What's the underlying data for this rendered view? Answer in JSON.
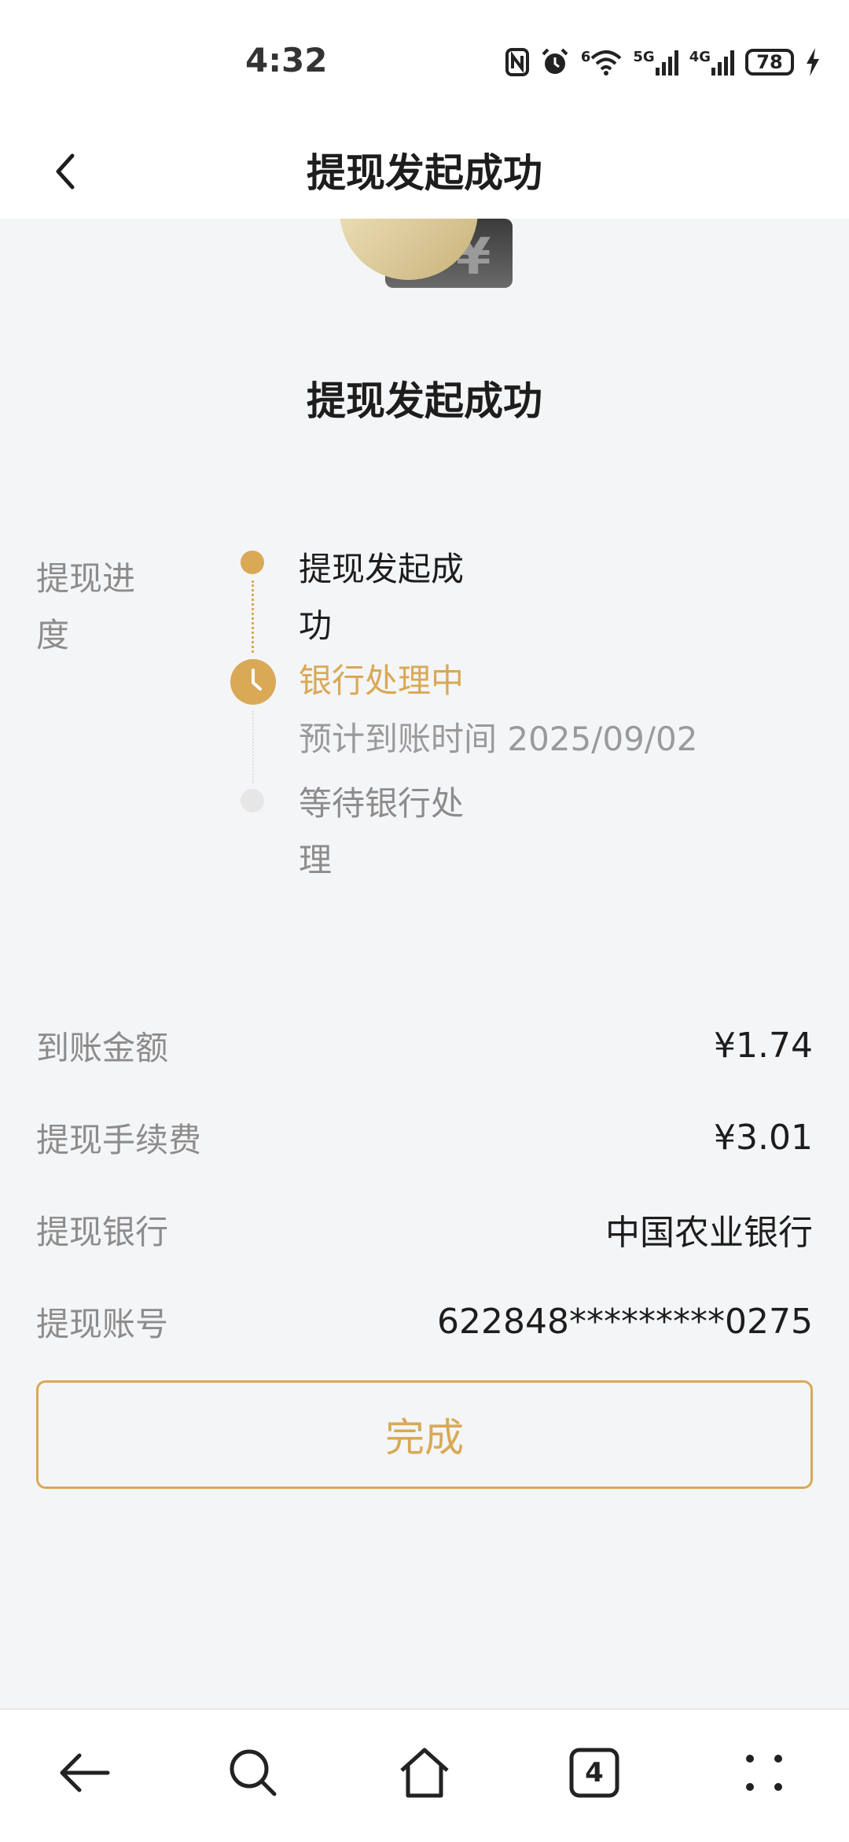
{
  "status_bar": {
    "time": "4:32",
    "wifi_tag": "6",
    "sim1_tag": "5G",
    "sim2_tag": "4G",
    "battery": "78"
  },
  "header": {
    "title": "提现发起成功"
  },
  "hero": {
    "currency_symbol": "¥"
  },
  "main": {
    "title": "提现发起成功"
  },
  "progress": {
    "label": "提现进度",
    "steps": [
      {
        "text": "提现发起成功",
        "state": "done"
      },
      {
        "text": "银行处理中",
        "sub": "预计到账时间 2025/09/02",
        "state": "current"
      },
      {
        "text": "等待银行处理",
        "state": "pending"
      }
    ]
  },
  "details": [
    {
      "label": "到账金额",
      "value": "¥1.74"
    },
    {
      "label": "提现手续费",
      "value": "¥3.01"
    },
    {
      "label": "提现银行",
      "value": "中国农业银行"
    },
    {
      "label": "提现账号",
      "value": "622848*********0275"
    }
  ],
  "actions": {
    "done_label": "完成"
  },
  "bottom_nav": {
    "tab_count": "4"
  },
  "colors": {
    "accent": "#d9a956",
    "background": "#f4f5f7"
  }
}
